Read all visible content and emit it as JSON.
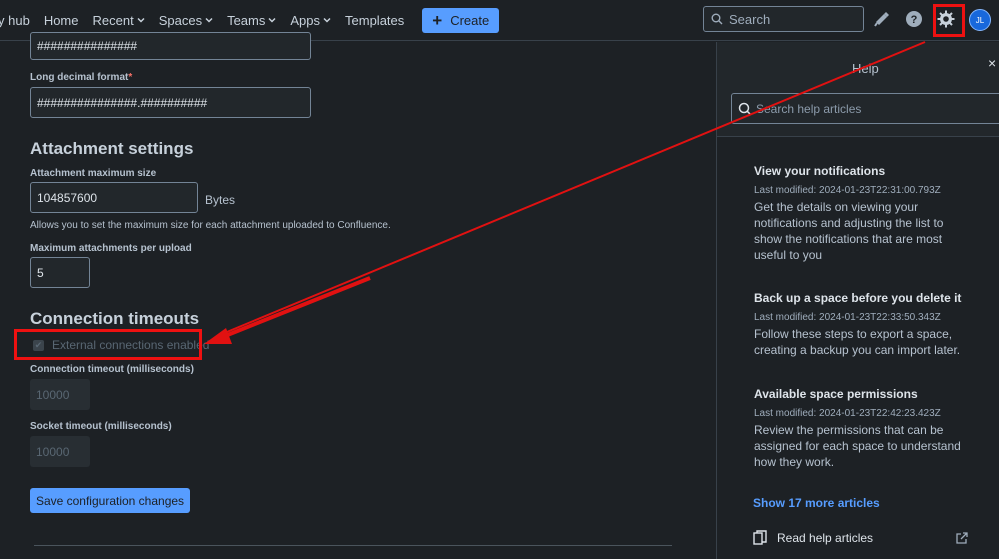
{
  "topbar": {
    "nav": [
      "y hub",
      "Home",
      "Recent",
      "Spaces",
      "Teams",
      "Apps",
      "Templates"
    ],
    "nav_dropdown": [
      false,
      false,
      true,
      true,
      true,
      true,
      false
    ],
    "create_label": "Create",
    "search_placeholder": "Search",
    "avatar_initials": "JL"
  },
  "form": {
    "short_number_value": "###############",
    "long_decimal_label": "Long decimal format",
    "long_decimal_required": "*",
    "long_decimal_value": "###############.##########",
    "attachment_title": "Attachment settings",
    "attachment_max_label": "Attachment maximum size",
    "attachment_max_value": "104857600",
    "attachment_unit": "Bytes",
    "attachment_helper": "Allows you to set the maximum size for each attachment uploaded to Confluence.",
    "max_attachments_label": "Maximum attachments per upload",
    "max_attachments_value": "5",
    "connection_title": "Connection timeouts",
    "external_connections_label": "External connections enabled",
    "connection_timeout_label": "Connection timeout (milliseconds)",
    "connection_timeout_value": "10000",
    "socket_timeout_label": "Socket timeout (milliseconds)",
    "socket_timeout_value": "10000",
    "save_label": "Save configuration changes"
  },
  "help": {
    "title": "Help",
    "close": "×",
    "search_placeholder": "Search help articles",
    "articles": [
      {
        "title": "View your notifications",
        "modified": "Last modified: 2024-01-23T22:31:00.793Z",
        "desc": "Get the details on viewing your notifications and adjusting the list to show the notifications that are most useful to you"
      },
      {
        "title": "Back up a space before you delete it",
        "modified": "Last modified: 2024-01-23T22:33:50.343Z",
        "desc": "Follow these steps to export a space, creating a backup you can import later."
      },
      {
        "title": "Available space permissions",
        "modified": "Last modified: 2024-01-23T22:42:23.423Z",
        "desc": "Review the permissions that can be assigned for each space to understand how they work."
      }
    ],
    "show_more": "Show 17 more articles",
    "read_help": "Read help articles"
  },
  "colors": {
    "accent": "#579dff",
    "annotation": "#e11111",
    "background": "#1d2125"
  },
  "icons": [
    "search-icon",
    "plus-icon",
    "megaphone-icon",
    "help-icon",
    "gear-icon",
    "close-icon",
    "document-icon",
    "external-link-icon",
    "checkmark-icon",
    "chevron-down-icon"
  ]
}
